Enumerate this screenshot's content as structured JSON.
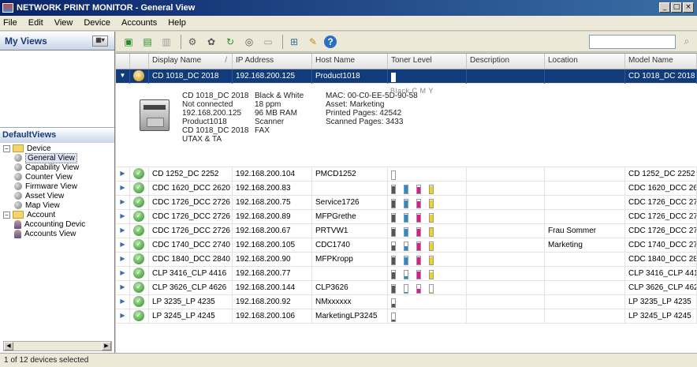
{
  "window": {
    "title": "NETWORK PRINT MONITOR - General View",
    "controls": [
      "_",
      "□",
      "×"
    ]
  },
  "menu": [
    "File",
    "Edit",
    "View",
    "Device",
    "Accounts",
    "Help"
  ],
  "left": {
    "my_views_title": "My Views",
    "default_views_title": "DefaultViews",
    "tree": {
      "device_label": "Device",
      "device_items": [
        "General View",
        "Capability View",
        "Counter View",
        "Firmware View",
        "Asset View",
        "Map View"
      ],
      "account_label": "Account",
      "account_items": [
        "Accounting Devic",
        "Accounts View"
      ]
    }
  },
  "search": {
    "placeholder": ""
  },
  "columns": [
    "Display Name",
    "/",
    "IP Address",
    "Host Name",
    "Toner Level",
    "Description",
    "Location",
    "Model Name"
  ],
  "colors": {
    "title_bar": "#0a246a",
    "selected_row": "#123b7a",
    "cyan": "#1e90d6",
    "magenta": "#e0198f",
    "yellow": "#f2d21a",
    "black": "#555555"
  },
  "selected": {
    "display_name": "CD 1018_DC 2018",
    "ip": "192.168.200.125",
    "host": "Product1018",
    "model": "CD 1018_DC 2018",
    "toner": [
      1.0
    ],
    "detail": {
      "col1": [
        "CD 1018_DC 2018",
        "Not connected",
        "192.168.200.125",
        "Product1018",
        "CD 1018_DC 2018",
        "UTAX & TA"
      ],
      "col2": [
        "Black & White",
        "18 ppm",
        "96 MB RAM",
        "Scanner",
        "FAX"
      ],
      "col3": [
        "MAC: 00-C0-EE-5D-90-58",
        "Asset: Marketing",
        "Printed Pages: 42542",
        "Scanned Pages: 3433"
      ],
      "toner_legend": "Black  C    M    Y"
    }
  },
  "rows": [
    {
      "name": "CD 1252_DC 2252",
      "ip": "192.168.200.104",
      "host": "PMCD1252",
      "desc": "",
      "loc": "",
      "model": "CD 1252_DC 2252",
      "toner": [
        0.0
      ]
    },
    {
      "name": "CDC 1620_DCC 2620",
      "ip": "192.168.200.83",
      "host": "",
      "desc": "",
      "loc": "",
      "model": "CDC 1620_DCC 2620",
      "toner": [
        0.9,
        0.95,
        0.8,
        0.9
      ]
    },
    {
      "name": "CDC 1726_DCC 2726",
      "ip": "192.168.200.75",
      "host": "Service1726",
      "desc": "",
      "loc": "",
      "model": "CDC 1726_DCC 2726",
      "toner": [
        0.9,
        0.85,
        0.8,
        0.9
      ]
    },
    {
      "name": "CDC 1726_DCC 2726",
      "ip": "192.168.200.89",
      "host": "MFPGrethe",
      "desc": "",
      "loc": "",
      "model": "CDC 1726_DCC 2726",
      "toner": [
        0.9,
        0.9,
        0.85,
        0.9
      ]
    },
    {
      "name": "CDC 1726_DCC 2726",
      "ip": "192.168.200.67",
      "host": "PRTVW1",
      "desc": "",
      "loc": "Frau Sommer",
      "model": "CDC 1726_DCC 2726",
      "toner": [
        0.9,
        0.9,
        0.85,
        0.95
      ]
    },
    {
      "name": "CDC 1740_DCC 2740",
      "ip": "192.168.200.105",
      "host": "CDC1740",
      "desc": "",
      "loc": "Marketing",
      "model": "CDC 1740_DCC 2740",
      "toner": [
        0.6,
        0.5,
        0.9,
        0.9
      ]
    },
    {
      "name": "CDC 1840_DCC 2840",
      "ip": "192.168.200.90",
      "host": "MFPKropp",
      "desc": "",
      "loc": "",
      "model": "CDC 1840_DCC 2840",
      "toner": [
        0.9,
        0.9,
        0.85,
        0.9
      ]
    },
    {
      "name": "CLP 3416_CLP 4416",
      "ip": "192.168.200.77",
      "host": "",
      "desc": "",
      "loc": "",
      "model": "CLP 3416_CLP 4416",
      "toner": [
        0.8,
        0.3,
        0.9,
        0.8
      ]
    },
    {
      "name": "CLP 3626_CLP 4626",
      "ip": "192.168.200.144",
      "host": "CLP3626",
      "desc": "",
      "loc": "",
      "model": "CLP 3626_CLP 4626",
      "toner": [
        0.9,
        0.05,
        0.5,
        0.05
      ]
    },
    {
      "name": "LP 3235_LP 4235",
      "ip": "192.168.200.92",
      "host": "NMxxxxxx",
      "desc": "",
      "loc": "",
      "model": "LP 3235_LP 4235",
      "toner": [
        0.4
      ]
    },
    {
      "name": "LP 3245_LP 4245",
      "ip": "192.168.200.106",
      "host": "MarketingLP3245",
      "desc": "",
      "loc": "",
      "model": "LP 3245_LP 4245",
      "toner": [
        0.15
      ]
    }
  ],
  "status": "1 of 12 devices selected"
}
